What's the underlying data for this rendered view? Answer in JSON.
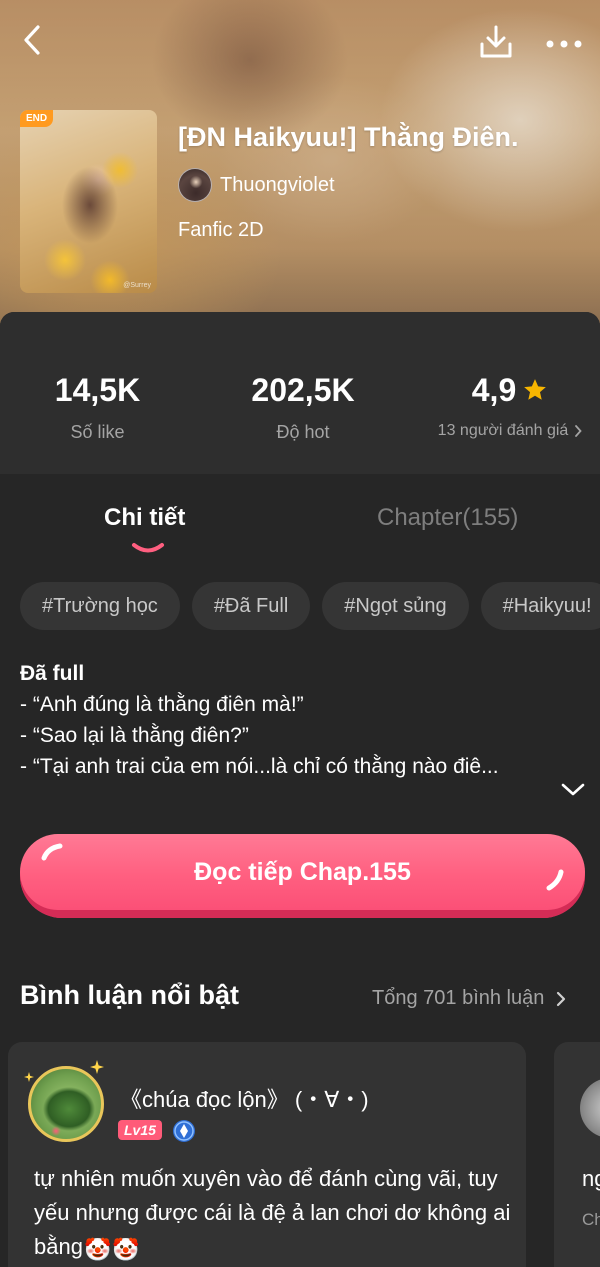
{
  "book": {
    "end_badge": "END",
    "cover_signature": "@Surrey",
    "title": "[ĐN Haikyuu!] Thằng Điên.",
    "author": "Thuongviolet",
    "genre": "Fanfic 2D"
  },
  "header": {
    "back_icon": "chevron-left-icon",
    "download_icon": "download-icon",
    "more_icon": "more-horizontal-icon"
  },
  "stats": {
    "likes_value": "14,5K",
    "likes_label": "Số like",
    "hot_value": "202,5K",
    "hot_label": "Độ hot",
    "rating_value": "4,9",
    "rating_count_label": "13 người đánh giá",
    "star_color": "#f7b500"
  },
  "tabs": [
    {
      "label": "Chi tiết",
      "active": true
    },
    {
      "label": "Chapter(155)",
      "active": false
    }
  ],
  "tags": [
    "#Trường học",
    "#Đã Full",
    "#Ngọt sủng",
    "#Haikyuu!"
  ],
  "description": {
    "heading": "Đã full",
    "lines": [
      "- “Anh đúng là thằng điên mà!”",
      "- “Sao lại là thằng điên?”",
      "- “Tại anh trai của em nói...là chỉ có thằng nào điê..."
    ]
  },
  "read_button": {
    "label": "Đọc tiếp Chap.155",
    "color": "#ff5f80"
  },
  "comments": {
    "section_title": "Bình luận nổi bật",
    "total_label": "Tổng 701 bình luận",
    "items": [
      {
        "user": "《chúa đọc lộn》 (・∀・)",
        "level": "Lv15",
        "text": "tự nhiên muốn xuyên vào để đánh cùng vãi, tuy yếu nhưng được cái là đệ ả lan chơi dơ không ai bằng",
        "emoji": [
          "🤡",
          "🤡"
        ]
      },
      {
        "text": "ng",
        "sub": "Ch"
      }
    ]
  }
}
